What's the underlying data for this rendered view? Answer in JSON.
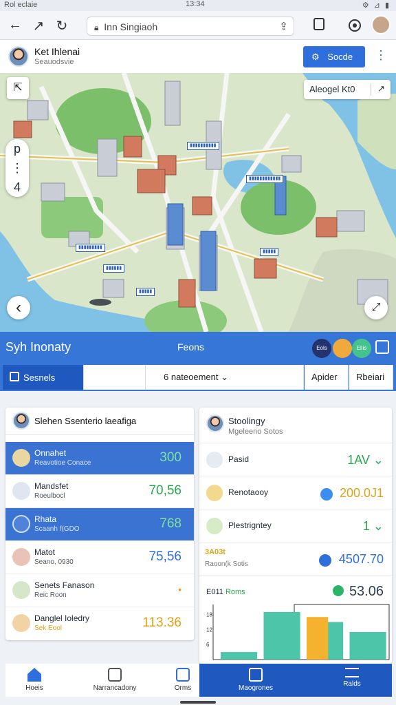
{
  "status_bar": {
    "left": "Rol eclaie",
    "time": "13:34",
    "right": "⚙ ⊿ ▮"
  },
  "browser": {
    "url": "Inn Singiaoh",
    "back_label": "←",
    "forward_label": "↗",
    "reload_label": "↻"
  },
  "app_header": {
    "name": "Ket Ihlenai",
    "subtitle": "Seauodsvie",
    "action_button": "Socde",
    "action_icon": "⚙"
  },
  "map": {
    "search_value": "Aleogel Kt0",
    "search_close": "↗",
    "collapse_label": "⇱",
    "zoom_in": "p",
    "zoom_dot": "⋮",
    "zoom_out": "4",
    "back_label": "‹",
    "expand_label": "⤢"
  },
  "panel": {
    "title": "Syh Inonaty",
    "center_label": "Feons",
    "dots": [
      {
        "label": "Eols",
        "color": "#24336e"
      },
      {
        "label": "",
        "color": "#f0a93b"
      },
      {
        "label": "Ellis",
        "color": "#45c38d"
      }
    ]
  },
  "tabs": [
    {
      "label": "Sesnels"
    },
    {
      "label": ""
    },
    {
      "label": "6 nateoement  ⌄"
    },
    {
      "label": "Apider"
    },
    {
      "label": "Rbeiari"
    }
  ],
  "left_card": {
    "title": "Slehen Ssenterio laeafiga",
    "rows": [
      {
        "name": "Onnahet",
        "sub": "Reavotioe Conace",
        "value": "300"
      },
      {
        "name": "Mandsfet",
        "sub": "Roeulbocl",
        "value": "70,56"
      },
      {
        "name": "Rhata",
        "sub": "Scaanh f(GDO",
        "value": "768"
      },
      {
        "name": "Matot",
        "sub": "Seano, 0930",
        "value": "75,56"
      },
      {
        "name": "Senets Fanason",
        "sub": "Reic Roon",
        "value": "•"
      },
      {
        "name": "Danglel Ioledry",
        "sub": "Sek Eool",
        "value": "113.36"
      }
    ]
  },
  "right_card": {
    "title": "Stoolingy",
    "subtitle": "Mgeleeno Sotos",
    "rows": [
      {
        "name": "Pasid",
        "value": "1AV ⌄"
      },
      {
        "name": "Renotaooy",
        "value": "200.0J1"
      },
      {
        "name": "Plestrigntey",
        "value": "1 ⌄"
      },
      {
        "name": "Raoon(k Sotis",
        "tag": "3A03t",
        "value": "4507.70"
      }
    ],
    "chart_title": "E011",
    "chart_title_tag": "Roms",
    "chart_value": "53.06"
  },
  "chart_data": {
    "type": "bar",
    "categories": [
      "",
      "",
      "",
      ""
    ],
    "series": [
      {
        "values": [
          3,
          19,
          15,
          11
        ],
        "color": "#4cc5a8"
      },
      {
        "values": [
          0,
          0,
          17,
          0
        ],
        "color": "#f4b22f"
      }
    ],
    "yticks": [
      "18",
      "12",
      "6"
    ],
    "ylim": [
      0,
      22
    ],
    "legend": "none"
  },
  "bottom_nav": [
    {
      "label": "Hoeis"
    },
    {
      "label": "Narrancadony"
    },
    {
      "label": "Orms"
    },
    {
      "label": "Maogrones"
    },
    {
      "label": "Ralds"
    }
  ]
}
